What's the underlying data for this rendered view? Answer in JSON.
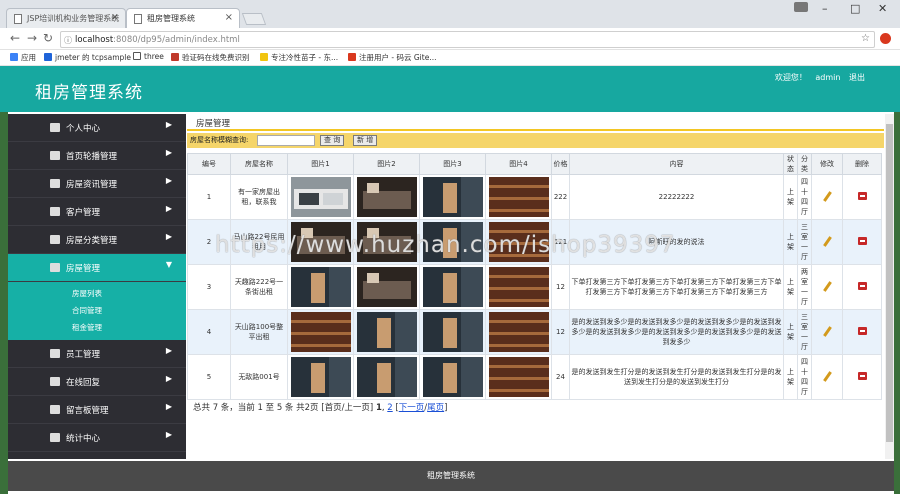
{
  "browser": {
    "tabs": [
      {
        "label": "JSP培训机构业务管理系统"
      },
      {
        "label": "租房管理系统"
      }
    ],
    "url_host": "localhost",
    "url_path": ":8080/dp95/admin/index.html",
    "bookmarks": [
      {
        "label": "应用",
        "color": "#3b82f6"
      },
      {
        "label": "jmeter 的 tcpsample",
        "color": "#1e63d8"
      },
      {
        "label": "three",
        "color": "#555555"
      },
      {
        "label": "验证码在线免费识别",
        "color": "#c0392b"
      },
      {
        "label": "专注冷性苗子 - 东...",
        "color": "#f1c40f"
      },
      {
        "label": "注册用户 - 码云 Gite...",
        "color": "#d9381e"
      }
    ]
  },
  "app": {
    "title": "租房管理系统",
    "welcome": "欢迎您！",
    "user": "admin",
    "logout": "退出",
    "footer": "租房管理系统"
  },
  "sidebar": {
    "items": [
      {
        "label": "个人中心",
        "active": false
      },
      {
        "label": "首页轮播管理",
        "active": false
      },
      {
        "label": "房屋资讯管理",
        "active": false
      },
      {
        "label": "客户管理",
        "active": false
      },
      {
        "label": "房屋分类管理",
        "active": false
      },
      {
        "label": "房屋管理",
        "active": true
      },
      {
        "label": "员工管理",
        "active": false
      },
      {
        "label": "在线回复",
        "active": false
      },
      {
        "label": "留言板管理",
        "active": false
      },
      {
        "label": "统计中心",
        "active": false
      }
    ],
    "submenu": [
      "房屋列表",
      "合同管理",
      "租金管理"
    ]
  },
  "content": {
    "heading": "房屋管理",
    "search_label": "房屋名称模糊查询:",
    "search_value": "",
    "search_button": "查 询",
    "add_button": "新 增",
    "columns": [
      "编号",
      "房屋名称",
      "图片1",
      "图片2",
      "图片3",
      "图片4",
      "价格",
      "内容",
      "状态",
      "分类",
      "修改",
      "删除"
    ],
    "rows": [
      {
        "id": "1",
        "name": "有一家房屋出租，联系我",
        "price": "222",
        "content": "22222222",
        "status": "上架",
        "category": "四十四厅"
      },
      {
        "id": "2",
        "name": "马山路22号民用租用",
        "price": "121",
        "content": "阿斯旺的发的说法",
        "status": "上架",
        "category": "三室一厅"
      },
      {
        "id": "3",
        "name": "天趣路222号一条街出租",
        "price": "12",
        "content": "下单打发第三方下单打发第三方下单打发第三方下单打发第三方下单打发第三方下单打发第三方下单打发第三方下单打发第三方",
        "status": "上架",
        "category": "两室一厅"
      },
      {
        "id": "4",
        "name": "天山路100号整平出租",
        "price": "12",
        "content": "是的发送到发多少是的发送到发多少是的发送到发多少是的发送到发多少是的发送到发多少是的发送到发多少是的发送到发多少是的发送到发多少",
        "status": "上架",
        "category": "三室一厅"
      },
      {
        "id": "5",
        "name": "无敌路001号",
        "price": "24",
        "content": "是的发送到发生打分是的发送到发生打分是的发送到发生打分是的发送到发生打分是的发送到发生打分",
        "status": "上架",
        "category": "四十四厅"
      }
    ],
    "pager": {
      "summary": "总共 7 条，当前 1 至 5 条 共2页",
      "nav_prefix": "[首页/上一页]",
      "page_current": "1",
      "page_2": "2",
      "next": "下一页",
      "last": "尾页"
    }
  },
  "watermark": "https://www.huzhan.com/ishop39397",
  "colors": {
    "accent": "#17a8a0",
    "sidebar_bg": "#2d2d33",
    "footer_bg": "#4a4a4a",
    "toolbar_yellow": "#f5d56a"
  }
}
